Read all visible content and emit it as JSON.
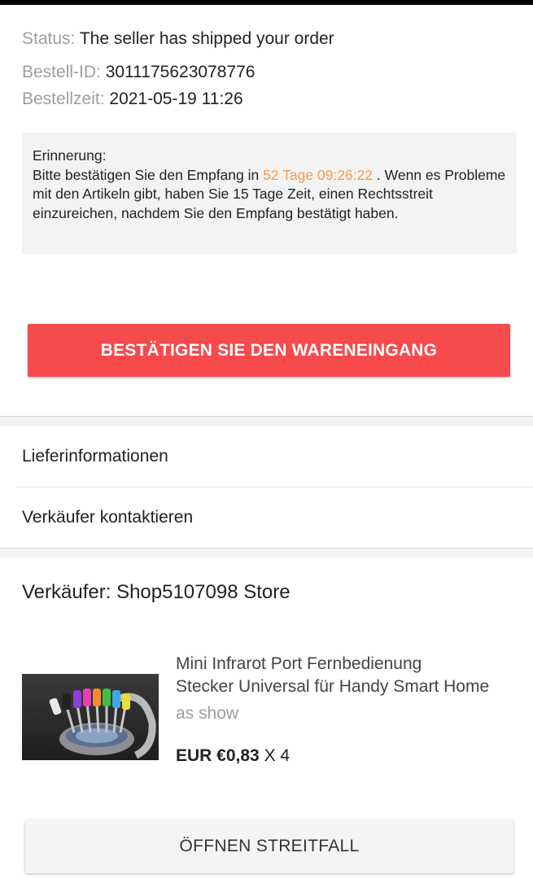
{
  "order": {
    "status_label": "Status:",
    "status_value": "The seller has shipped your order",
    "id_label": "Bestell-ID:",
    "id_value": "3011175623078776",
    "time_label": "Bestellzeit:",
    "time_value": "2021-05-19 11:26"
  },
  "reminder": {
    "title": "Erinnerung:",
    "text_before": "Bitte bestätigen Sie den Empfang in ",
    "countdown": "52 Tage 09:26:22",
    "text_after": " . Wenn es Probleme mit den Artikeln gibt, haben Sie 15 Tage Zeit, einen Rechtsstreit einzureichen, nachdem Sie den Empfang bestätigt haben."
  },
  "actions": {
    "confirm_label": "BESTÄTIGEN SIE DEN WARENEINGANG",
    "dispute_label": "ÖFFNEN STREITFALL"
  },
  "links": {
    "delivery_info": "Lieferinformationen",
    "contact_seller": "Verkäufer kontaktieren"
  },
  "seller": {
    "label": "Verkäufer: Shop5107098 Store"
  },
  "product": {
    "title_line1": "Mini Infrarot Port Fernbedienung",
    "title_line2": "Stecker Universal für Handy Smart Home",
    "variant": "as show",
    "price": "EUR €0,83",
    "quantity": "X 4"
  },
  "colors": {
    "accent_red": "#f64a4d",
    "countdown_orange": "#f29a52",
    "muted_gray": "#9e9e9e"
  }
}
